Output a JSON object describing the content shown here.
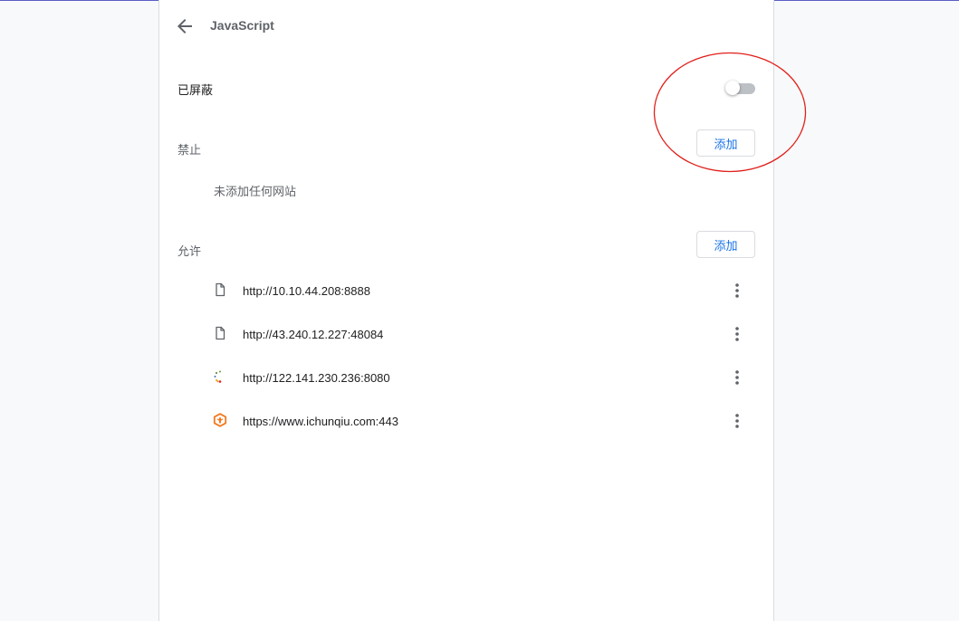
{
  "header": {
    "title": "JavaScript",
    "back_icon": "arrow-back-icon"
  },
  "blocked_toggle": {
    "label": "已屏蔽",
    "checked": false
  },
  "block_section": {
    "label": "禁止",
    "add_label": "添加",
    "empty_text": "未添加任何网站"
  },
  "allow_section": {
    "label": "允许",
    "add_label": "添加",
    "sites": [
      {
        "url": "http://10.10.44.208:8888",
        "icon": "page-icon"
      },
      {
        "url": "http://43.240.12.227:48084",
        "icon": "page-icon"
      },
      {
        "url": "http://122.141.230.236:8080",
        "icon": "loading-spinner-icon"
      },
      {
        "url": "https://www.ichunqiu.com:443",
        "icon": "ichunqiu-favicon"
      }
    ]
  },
  "colors": {
    "accent": "#1a73e8",
    "annotation": "#e0201b",
    "favicon": "#f47920"
  }
}
